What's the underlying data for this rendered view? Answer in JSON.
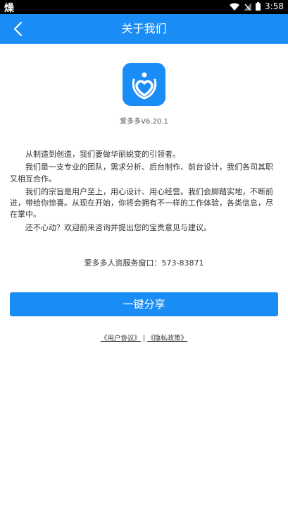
{
  "status_bar": {
    "left_glyph": "燥",
    "time": "3:58"
  },
  "header": {
    "title": "关于我们"
  },
  "about": {
    "version": "爱多多V6.20.1",
    "paragraphs": [
      "从制造到创造，我们要做华丽蜕变的引领者。",
      "我们是一支专业的团队，需求分析、后台制作、前台设计，我们各司其职又相互合作。",
      "我们的宗旨是用户至上，用心设计、用心经营。我们会脚踏实地，不断前进，带给你惊喜。从现在开始，你将会拥有不一样的工作体验，各类信息，尽在掌中。",
      "还不心动？欢迎前来咨询并提出您的宝贵意见与建议。"
    ],
    "contact": "爱多多人资服务窗口：573-83871"
  },
  "share_button": "一键分享",
  "links": {
    "user_agreement": "《用户协议》",
    "separator": " | ",
    "privacy_policy": "《隐私政策》"
  },
  "colors": {
    "primary": "#1a8cf5",
    "status_bar": "#000000"
  },
  "icons": {
    "back": "chevron-left-icon",
    "logo": "heart-person-icon",
    "wifi": "wifi-icon",
    "signal": "signal-icon",
    "battery": "battery-icon"
  }
}
